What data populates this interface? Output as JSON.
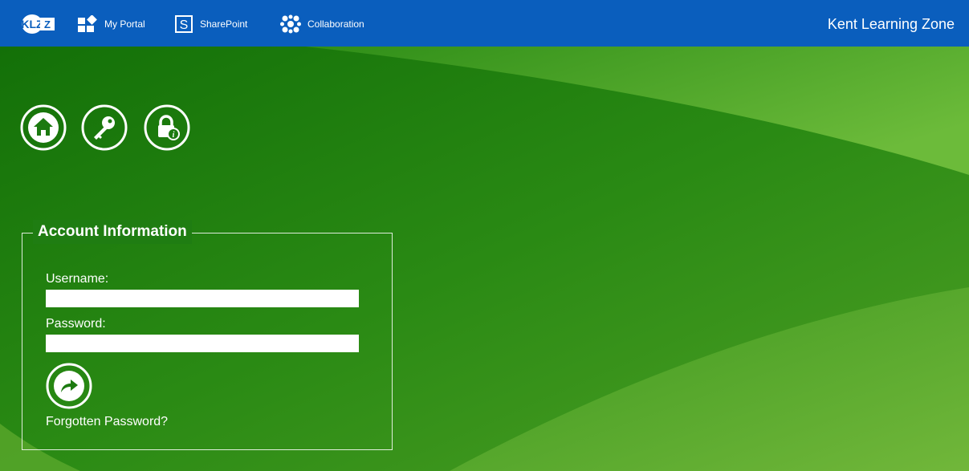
{
  "header": {
    "logo_text": "KLZ",
    "nav": [
      {
        "label": "My Portal",
        "icon": "portal-icon"
      },
      {
        "label": "SharePoint",
        "icon": "sharepoint-icon",
        "glyph": "S"
      },
      {
        "label": "Collaboration",
        "icon": "collaboration-icon"
      }
    ],
    "site_title": "Kent Learning Zone"
  },
  "quick_actions": [
    {
      "icon": "home-icon"
    },
    {
      "icon": "key-icon"
    },
    {
      "icon": "lock-info-icon"
    }
  ],
  "account": {
    "legend": "Account Information",
    "username_label": "Username:",
    "username_value": "",
    "password_label": "Password:",
    "password_value": "",
    "submit_icon": "arrow-right-icon",
    "forgot_label": "Forgotten Password?"
  },
  "colors": {
    "header": "#0a5ebd",
    "background_dark": "#1b7a0e",
    "background_light": "#6ab83a",
    "text": "#ffffff"
  }
}
